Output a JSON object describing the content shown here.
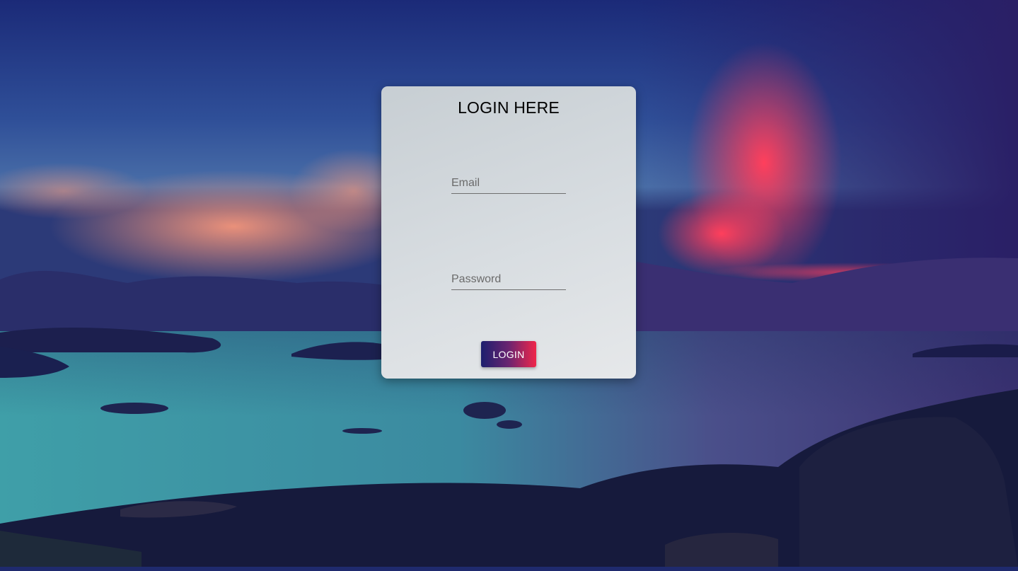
{
  "login": {
    "title": "LOGIN HERE",
    "email_placeholder": "Email",
    "password_placeholder": "Password",
    "button_label": "LOGIN"
  },
  "colors": {
    "button_gradient_start": "#1c1f6e",
    "button_gradient_end": "#f0264a",
    "card_background": "#d3d8dc",
    "bottom_bar": "#1f2a6e"
  },
  "background": {
    "scene": "sunset-seascape-image"
  }
}
